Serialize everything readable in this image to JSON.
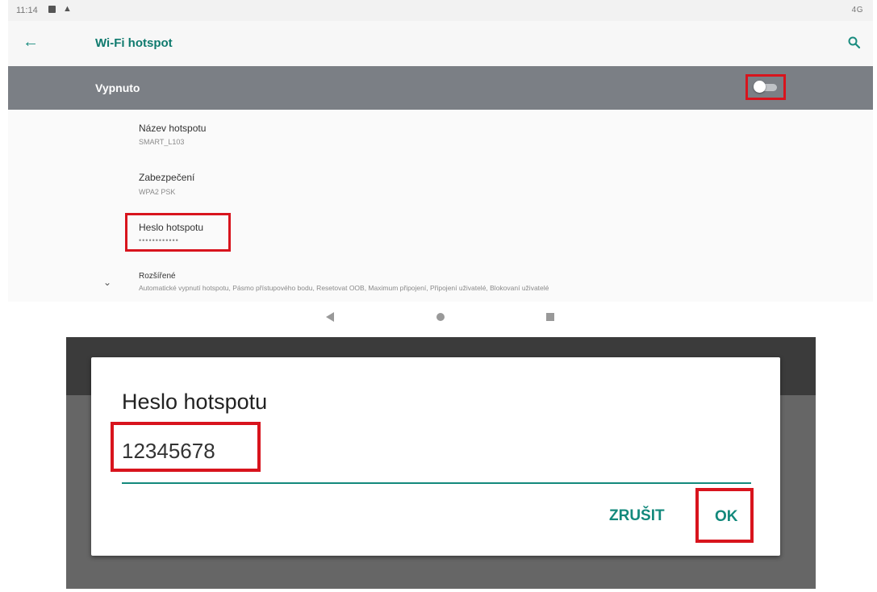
{
  "status_bar": {
    "time": "11:14",
    "right_indicators": "4G"
  },
  "app_bar": {
    "title": "Wi-Fi hotspot",
    "icons": [
      "back-arrow-icon",
      "search-icon"
    ]
  },
  "master_switch": {
    "label": "Vypnuto",
    "state": "off"
  },
  "settings": [
    {
      "title": "Název hotspotu",
      "subtitle": "SMART_L103"
    },
    {
      "title": "Zabezpečení",
      "subtitle": "WPA2 PSK"
    },
    {
      "title": "Heslo hotspotu",
      "subtitle": "••••••••••••"
    },
    {
      "title": "Rozšířené",
      "subtitle": "Automatické vypnutí hotspotu, Pásmo přístupového bodu, Resetovat OOB, Maximum připojení, Připojení uživatelé, Blokovaní uživatelé"
    }
  ],
  "dialog": {
    "title": "Heslo hotspotu",
    "input_value": "12345678",
    "cancel_label": "ZRUŠIT",
    "ok_label": "OK"
  },
  "colors": {
    "accent": "#13897c",
    "highlight": "#d8141d",
    "master_bar": "#7b7f85"
  }
}
